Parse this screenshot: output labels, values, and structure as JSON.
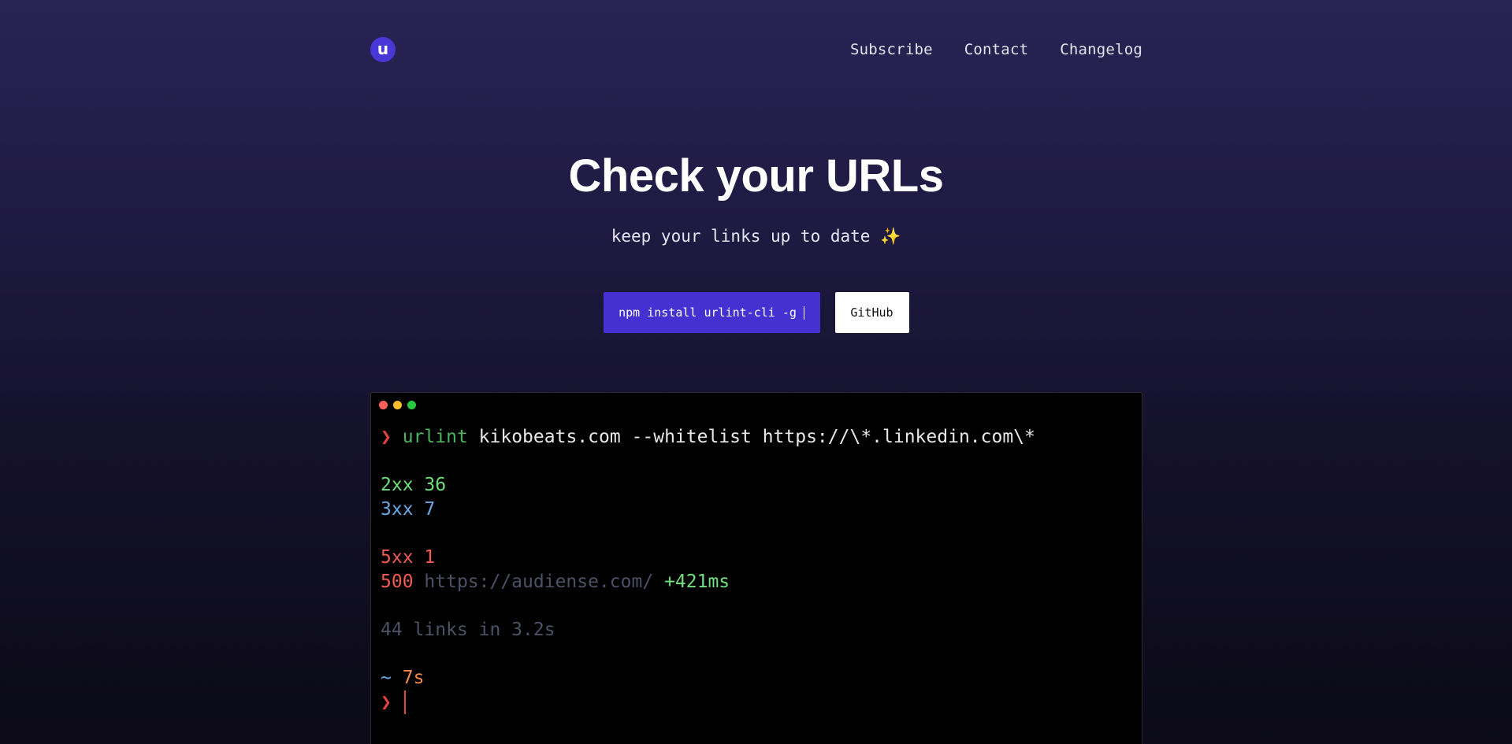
{
  "header": {
    "logo_letter": "u",
    "nav": [
      "Subscribe",
      "Contact",
      "Changelog"
    ]
  },
  "hero": {
    "title": "Check your URLs",
    "subtitle": "keep your links up to date",
    "sparkle": "✨"
  },
  "cta": {
    "install_command": "npm install urlint-cli -g",
    "github_label": "GitHub"
  },
  "terminal": {
    "prompt_symbol": "❯",
    "command_name": "urlint",
    "command_args": "kikobeats.com --whitelist https://\\*.linkedin.com\\*",
    "stats": {
      "s2xx_label": "2xx",
      "s2xx_count": "36",
      "s3xx_label": "3xx",
      "s3xx_count": "7",
      "s5xx_label": "5xx",
      "s5xx_count": "1"
    },
    "error_row": {
      "code": "500",
      "url": "https://audiense.com/",
      "time": "+421ms"
    },
    "summary": "44 links in 3.2s",
    "elapsed_tilde": "~",
    "elapsed": "7s"
  },
  "colors": {
    "accent": "#4531d2",
    "ok": "#6fe07d",
    "redirect": "#6aa9e6",
    "error": "#ef5a52",
    "prompt": "#e2453c"
  },
  "icons": [
    "urlint-logo-icon",
    "window-close-dot-icon",
    "window-minimize-dot-icon",
    "window-maximize-dot-icon"
  ]
}
